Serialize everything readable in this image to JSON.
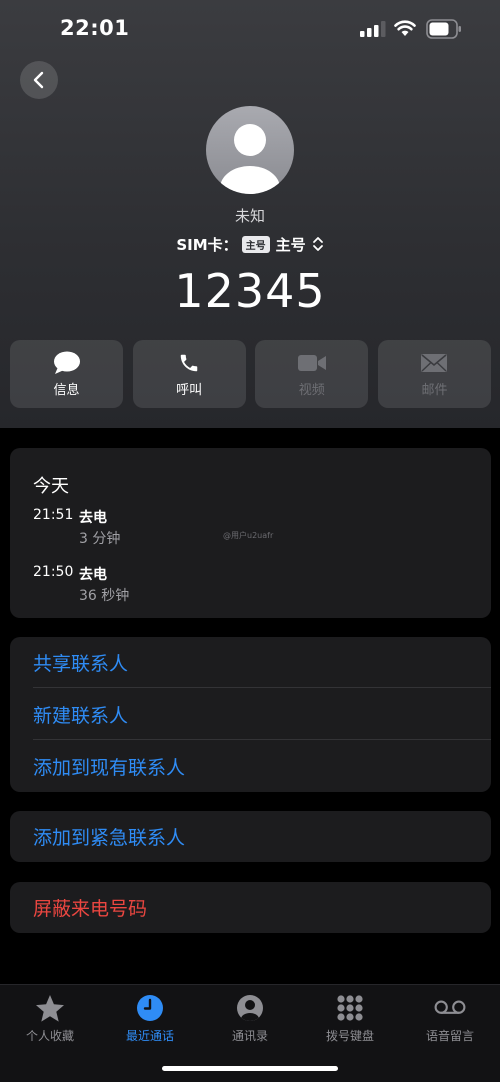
{
  "status_bar": {
    "time": "22:01"
  },
  "contact": {
    "name": "未知",
    "sim_label": "SIM卡：",
    "sim_badge": "主号",
    "sim_name": "主号",
    "number": "12345"
  },
  "actions": [
    {
      "label": "信息",
      "icon": "message-icon",
      "enabled": true
    },
    {
      "label": "呼叫",
      "icon": "phone-icon",
      "enabled": true
    },
    {
      "label": "视频",
      "icon": "video-icon",
      "enabled": false
    },
    {
      "label": "邮件",
      "icon": "mail-icon",
      "enabled": false
    }
  ],
  "history": {
    "title": "今天",
    "calls": [
      {
        "time": "21:51",
        "type": "去电",
        "duration": "3 分钟"
      },
      {
        "time": "21:50",
        "type": "去电",
        "duration": "36 秒钟"
      }
    ],
    "watermark": "@用户u2uafr"
  },
  "menu": {
    "share_contact": "共享联系人",
    "new_contact": "新建联系人",
    "add_to_existing": "添加到现有联系人",
    "add_to_emergency": "添加到紧急联系人",
    "block_caller": "屏蔽来电号码"
  },
  "colors": {
    "accent": "#2f8cf5",
    "danger": "#ea4640",
    "card": "#1c1c1e"
  },
  "tab_bar": {
    "tabs": [
      {
        "label": "个人收藏",
        "icon": "star-icon",
        "active": false
      },
      {
        "label": "最近通话",
        "icon": "clock-icon",
        "active": true
      },
      {
        "label": "通讯录",
        "icon": "contact-icon",
        "active": false
      },
      {
        "label": "拨号键盘",
        "icon": "keypad-icon",
        "active": false
      },
      {
        "label": "语音留言",
        "icon": "voicemail-icon",
        "active": false
      }
    ]
  }
}
